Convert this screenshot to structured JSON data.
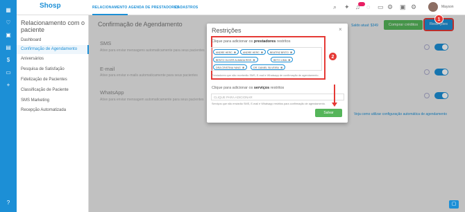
{
  "app": {
    "logo": "Shosp"
  },
  "rail_icons": [
    "grid-icon",
    "heart-icon",
    "calendar-icon",
    "card-icon",
    "money-icon",
    "folder-icon",
    "plus-icon"
  ],
  "nav": {
    "items": [
      "RELACIONAMENTO",
      "AGENDA DE PRESTADORES",
      "CADASTROS"
    ]
  },
  "user": {
    "name": "Mayson"
  },
  "sidebar": {
    "title": "Relacionamento com o paciente",
    "items": [
      "Dashboard",
      "Confirmação de Agendamento",
      "Aniversários",
      "Pesquisa de Satisfação",
      "Fidelização de Pacientes",
      "Classificação de Paciente",
      "SMS Marketing",
      "Recepção Automatizada"
    ]
  },
  "main": {
    "title": "Confirmação de Agendamento",
    "balance": "Saldo atual: $349",
    "buy_credits": "Comprar créditos",
    "restrictions_btn": "Restrições",
    "sections": [
      {
        "name": "SMS",
        "desc": "Ative para enviar mensagens automaticamente para seus pacientes"
      },
      {
        "name": "E-mail",
        "desc": "Ative para enviar e-mails automaticamente para seus pacientes"
      },
      {
        "name": "WhatsApp",
        "desc": "Ative para enviar mensagem automaticamente para seus pacientes"
      }
    ],
    "help_link": "Veja como utilizar configuração automática de agendamento"
  },
  "modal": {
    "title": "Restrições",
    "close": "×",
    "prest_label_pre": "Clique para adicionar os",
    "prest_label_bold": "prestadores",
    "prest_label_post": "restritos",
    "chips": [
      "ANDRE HERC",
      "ANDRE HERC",
      "BEATRIZ BRITO",
      "BENTO OLIVER ALMADA REIS",
      "BETO LIMA",
      "DRA CRISTINA YANG",
      "DR. DANIEL SILVEIRA"
    ],
    "prest_hint": "Prestadores que não receberão SMS, E-mail e Whatsapp de confirmação de agendamento.",
    "serv_label_pre": "Clique para adicionar os",
    "serv_label_bold": "serviços",
    "serv_label_post": "restritos",
    "serv_placeholder": "CLIQUE PARA ADICIONAR",
    "serv_hint": "Serviços que não enviarão SMS, E-mail e Whatsapp restritos para confirmação de agendamento.",
    "save": "Salvar"
  },
  "markers": [
    "1",
    "2"
  ],
  "colors": {
    "brand": "#1c8fd6",
    "green": "#55b55a",
    "annotation": "#e53935"
  }
}
